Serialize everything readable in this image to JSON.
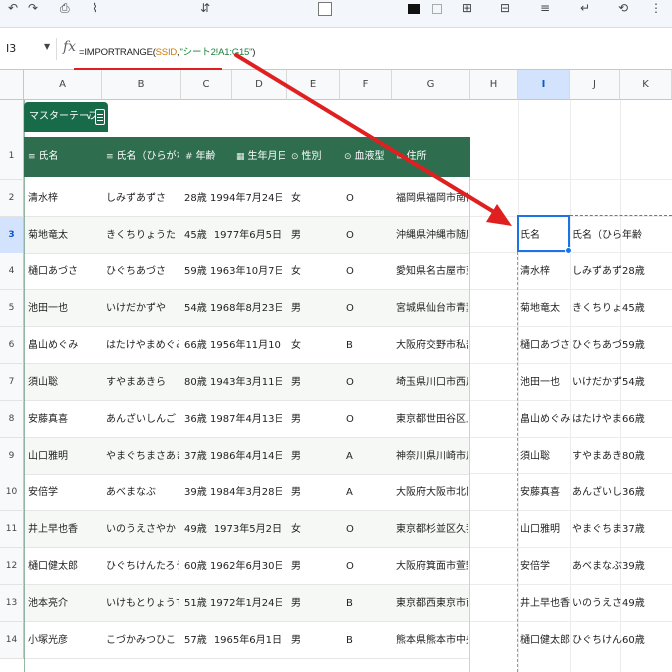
{
  "formula_bar": {
    "cell_ref": "I3",
    "fx_label": "fx",
    "formula_fn": "=IMPORTRANGE(",
    "formula_arg": "SSID",
    "formula_sep": ",",
    "formula_str": "\"シート2!A1:G15\"",
    "formula_close": ")"
  },
  "columns": [
    "A",
    "B",
    "C",
    "D",
    "E",
    "F",
    "G",
    "H",
    "I",
    "J",
    "K"
  ],
  "rows": [
    "1",
    "2",
    "3",
    "4",
    "5",
    "6",
    "7",
    "8",
    "9",
    "10",
    "11",
    "12",
    "13",
    "14"
  ],
  "selected_cell": {
    "column": "I",
    "row": "3"
  },
  "table": {
    "name": "マスターテーブル",
    "headers": [
      "氏名",
      "氏名（ひらがな）",
      "年齢",
      "生年月日",
      "性別",
      "血液型",
      "住所"
    ],
    "rows": [
      [
        "清水梓",
        "しみずあずさ",
        "28歳",
        "1994年7月24日",
        "女",
        "O",
        "福岡県福岡市南区弥永"
      ],
      [
        "菊地竜太",
        "きくちりょうた",
        "45歳",
        "1977年6月5日",
        "男",
        "O",
        "沖縄県沖縄市随慶3-2-6"
      ],
      [
        "樋口あづさ",
        "ひぐちあづさ",
        "59歳",
        "1963年10月7日",
        "女",
        "O",
        "愛知県名古屋市東区大幸"
      ],
      [
        "池田一也",
        "いけだかずや",
        "54歳",
        "1968年8月23日",
        "男",
        "O",
        "宮城県仙台市青葉区国見"
      ],
      [
        "畠山めぐみ",
        "はたけやまめぐみ",
        "66歳",
        "1956年11月10日",
        "女",
        "B",
        "大阪府交野市私部南2-3"
      ],
      [
        "須山聡",
        "すやまあきら",
        "80歳",
        "1943年3月11日",
        "男",
        "O",
        "埼玉県川口市西川口2-1-"
      ],
      [
        "安藤真喜",
        "あんざいしんご",
        "36歳",
        "1987年4月13日",
        "男",
        "O",
        "東京都世田谷区上馬2-4-"
      ],
      [
        "山口雅明",
        "やまぐちまさあき",
        "37歳",
        "1986年4月14日",
        "男",
        "A",
        "神奈川県川崎市川崎区四"
      ],
      [
        "安倍学",
        "あべまなぶ",
        "39歳",
        "1984年3月28日",
        "男",
        "A",
        "大阪府大阪市北区西天満"
      ],
      [
        "井上早也香",
        "いのうえさやか",
        "49歳",
        "1973年5月2日",
        "女",
        "O",
        "東京都杉並区久我山4-1-"
      ],
      [
        "樋口健太郎",
        "ひぐちけんたろう",
        "60歳",
        "1962年6月30日",
        "男",
        "O",
        "大阪府箕面市萱野4-3-6"
      ],
      [
        "池本亮介",
        "いけもとりょうすけ",
        "51歳",
        "1972年1月24日",
        "男",
        "B",
        "東京都西東京市南町2-5-"
      ],
      [
        "小塚光彦",
        "こづかみつひこ",
        "57歳",
        "1965年6月1日",
        "男",
        "B",
        "熊本県熊本市中央区南熊"
      ]
    ]
  },
  "import_result": {
    "header": [
      "氏名",
      "氏名（ひらがな）",
      "年齢"
    ],
    "rows": [
      [
        "清水梓",
        "しみずあずさ",
        "28歳"
      ],
      [
        "菊地竜太",
        "きくちりょうた",
        "45歳"
      ],
      [
        "樋口あづさ",
        "ひぐちあづさ",
        "59歳"
      ],
      [
        "池田一也",
        "いけだかずや",
        "54歳"
      ],
      [
        "畠山めぐみ",
        "はたけやまめぐみ",
        "66歳"
      ],
      [
        "須山聡",
        "すやまあきら",
        "80歳"
      ],
      [
        "安藤真喜",
        "あんざいしんご",
        "36歳"
      ],
      [
        "山口雅明",
        "やまぐちまさあき",
        "37歳"
      ],
      [
        "安倍学",
        "あべまなぶ",
        "39歳"
      ],
      [
        "井上早也香",
        "いのうえさやか",
        "49歳"
      ],
      [
        "樋口健太郎",
        "ひぐちけんたろう",
        "60歳"
      ]
    ]
  },
  "colors": {
    "table_header": "#2e6e4e",
    "annotation_red": "#e02020",
    "selection_blue": "#1a73e8"
  }
}
